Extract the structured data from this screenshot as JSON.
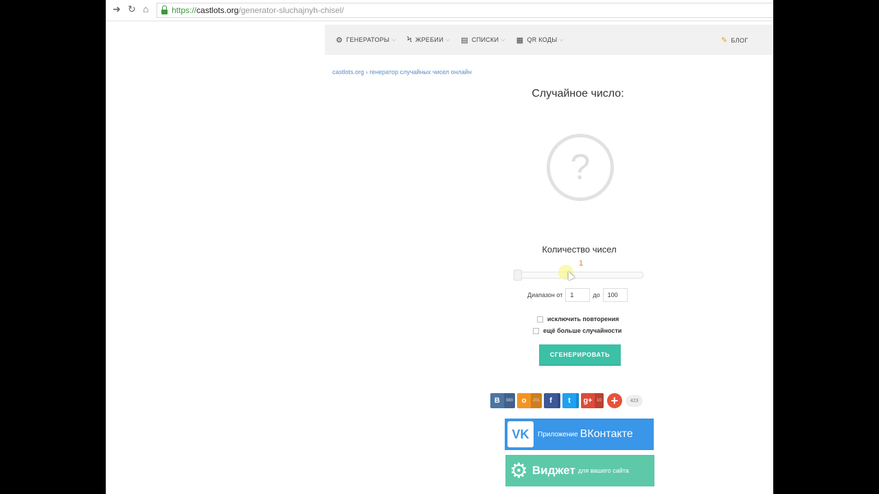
{
  "browser": {
    "url_protocol": "https://",
    "url_host": "castlots.org",
    "url_path": "/generator-sluchajnyh-chisel/"
  },
  "nav": {
    "items": [
      {
        "label": "ГЕНЕРАТОРЫ",
        "icon": "gears-icon"
      },
      {
        "label": "ЖРЕБИИ",
        "icon": "lightning-icon"
      },
      {
        "label": "СПИСКИ",
        "icon": "list-icon"
      },
      {
        "label": "QR КОДЫ",
        "icon": "qr-icon"
      }
    ],
    "blog_label": "БЛОГ"
  },
  "breadcrumb": {
    "home": "castlots.org",
    "separator": "›",
    "current": "генератор случайных чисел онлайн"
  },
  "main": {
    "title": "Случайное число:",
    "placeholder_glyph": "?",
    "count_label": "Количество чисел",
    "count_value": "1",
    "range_from_label": "Диапазон от",
    "range_to_label": "до",
    "range_from_value": "1",
    "range_to_value": "100",
    "option_no_repeat": "исключить повторения",
    "option_more_random": "ещё больше случайности",
    "generate_label": "СГЕНЕРИРОВАТЬ"
  },
  "share": {
    "vk": {
      "glyph": "В",
      "count": "980",
      "color": "#4c75a3"
    },
    "ok": {
      "glyph": "о",
      "count": "201",
      "color": "#f39422"
    },
    "fb": {
      "glyph": "f",
      "count": "",
      "color": "#3b5998"
    },
    "tw": {
      "glyph": "t",
      "count": "",
      "color": "#1da1f2"
    },
    "gp": {
      "glyph": "g+",
      "count": "10",
      "color": "#dd4b39"
    },
    "total": "423"
  },
  "banners": {
    "vk_small": "Приложение",
    "vk_big": "ВКонтакте",
    "widget_big": "Виджет",
    "widget_small": "для вашего сайта"
  },
  "colors": {
    "accent": "#3cc0a6",
    "link": "#5b8fc7",
    "count_value": "#e07b28"
  }
}
